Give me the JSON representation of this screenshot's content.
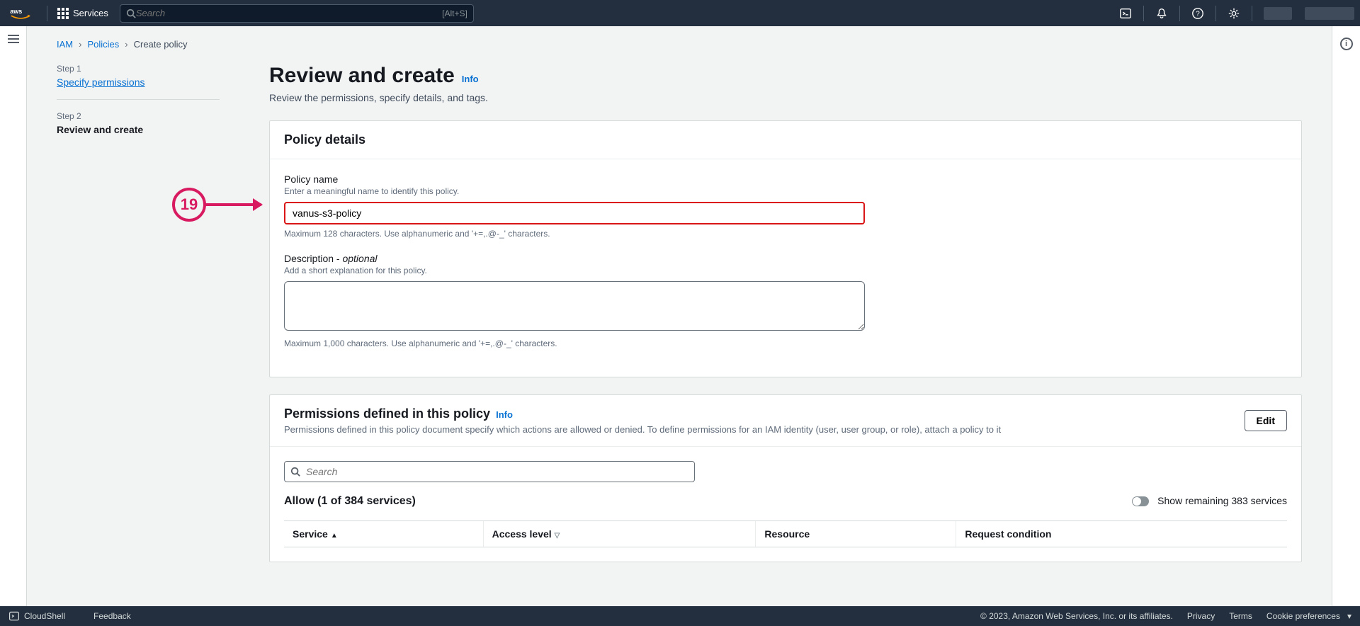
{
  "nav": {
    "services": "Services",
    "search_placeholder": "Search",
    "search_hint": "[Alt+S]"
  },
  "breadcrumb": {
    "root": "IAM",
    "second": "Policies",
    "current": "Create policy"
  },
  "steps": {
    "s1_tag": "Step 1",
    "s1_label": "Specify permissions",
    "s2_tag": "Step 2",
    "s2_label": "Review and create"
  },
  "page": {
    "title": "Review and create",
    "info": "Info",
    "subtitle": "Review the permissions, specify details, and tags."
  },
  "policy_details": {
    "panel_title": "Policy details",
    "name_label": "Policy name",
    "name_help": "Enter a meaningful name to identify this policy.",
    "name_value": "vanus-s3-policy",
    "name_constraint": "Maximum 128 characters. Use alphanumeric and '+=,.@-_' characters.",
    "desc_label": "Description - ",
    "desc_optional": "optional",
    "desc_help": "Add a short explanation for this policy.",
    "desc_value": "",
    "desc_constraint": "Maximum 1,000 characters. Use alphanumeric and '+=,.@-_' characters."
  },
  "permissions": {
    "panel_title": "Permissions defined in this policy",
    "panel_info": "Info",
    "panel_desc": "Permissions defined in this policy document specify which actions are allowed or denied. To define permissions for an IAM identity (user, user group, or role), attach a policy to it",
    "edit": "Edit",
    "search_placeholder": "Search",
    "allow_text": "Allow (1 of 384 services)",
    "toggle_label": "Show remaining 383 services",
    "columns": {
      "service": "Service",
      "access": "Access level",
      "resource": "Resource",
      "condition": "Request condition"
    }
  },
  "footer": {
    "cloudshell": "CloudShell",
    "feedback": "Feedback",
    "copyright": "© 2023, Amazon Web Services, Inc. or its affiliates.",
    "privacy": "Privacy",
    "terms": "Terms",
    "cookie": "Cookie preferences"
  },
  "annotation": {
    "number": "19"
  },
  "colors": {
    "accent_red": "#d81b60",
    "link": "#0972d3",
    "header": "#232f3e"
  }
}
